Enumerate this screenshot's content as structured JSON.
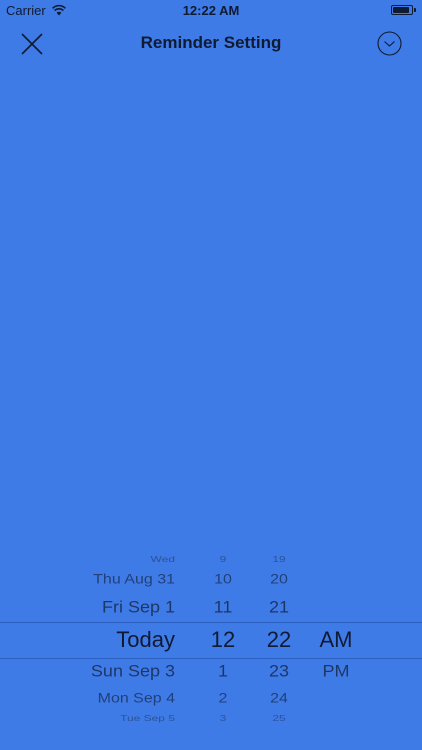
{
  "status_bar": {
    "carrier": "Carrier",
    "time": "12:22 AM",
    "battery_level": 0.9
  },
  "nav": {
    "title": "Reminder Setting",
    "close_icon": "close-icon",
    "confirm_icon": "chevron-down-circle-icon"
  },
  "picker": {
    "day_column": [
      "Wed",
      "Thu Aug 31",
      "Fri Sep 1",
      "Today",
      "Sun Sep 3",
      "Mon Sep 4",
      "Tue Sep 5"
    ],
    "hour_column": [
      "9",
      "10",
      "11",
      "12",
      "1",
      "2",
      "3"
    ],
    "minute_column": [
      "19",
      "20",
      "21",
      "22",
      "23",
      "24",
      "25"
    ],
    "ampm_column": [
      "AM",
      "PM"
    ],
    "selected": {
      "day": "Today",
      "hour": "12",
      "minute": "22",
      "ampm": "AM"
    }
  },
  "colors": {
    "background": "#3f7be6",
    "text": "#0f1a33",
    "selection_line": "#2a5fc0"
  }
}
